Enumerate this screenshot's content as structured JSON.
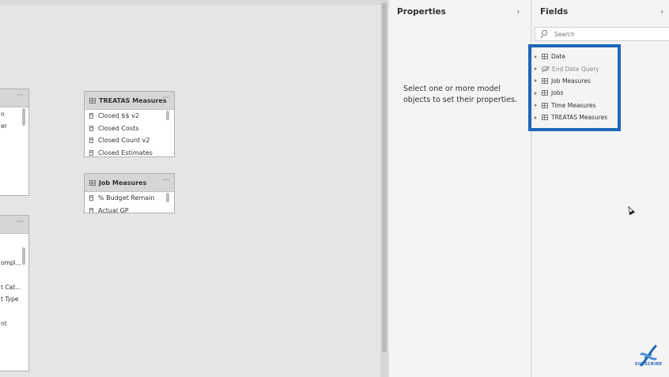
{
  "canvas": {
    "cards": [
      {
        "title": "",
        "fields": [
          "n",
          "er"
        ]
      },
      {
        "title": "TREATAS Measures",
        "fields": [
          "Closed $$ v2",
          "Closed Costs",
          "Closed Count v2",
          "Closed Estimates"
        ]
      },
      {
        "title": "Job Measures",
        "fields": [
          "% Budget Remain",
          "Actual GP"
        ]
      },
      {
        "title": "",
        "fields": [
          "ompl...",
          "t Cat...",
          "t Type",
          "nt"
        ]
      }
    ],
    "more_label": "···"
  },
  "properties": {
    "title": "Properties",
    "message": "Select one or more model objects to set their properties."
  },
  "fields": {
    "title": "Fields",
    "search_placeholder": "Search",
    "items": [
      {
        "label": "Date",
        "icon": "table-icon",
        "hidden": false
      },
      {
        "label": "End Date Query",
        "icon": "hidden-icon",
        "hidden": true
      },
      {
        "label": "Job Measures",
        "icon": "table-icon",
        "hidden": false
      },
      {
        "label": "Jobs",
        "icon": "table-icon",
        "hidden": false
      },
      {
        "label": "Time Measures",
        "icon": "table-icon",
        "hidden": false
      },
      {
        "label": "TREATAS Measures",
        "icon": "table-icon",
        "hidden": false
      }
    ]
  },
  "overlay": {
    "highlight_color": "#1d67b8",
    "subscribe_label": "SUBSCRIBE"
  }
}
